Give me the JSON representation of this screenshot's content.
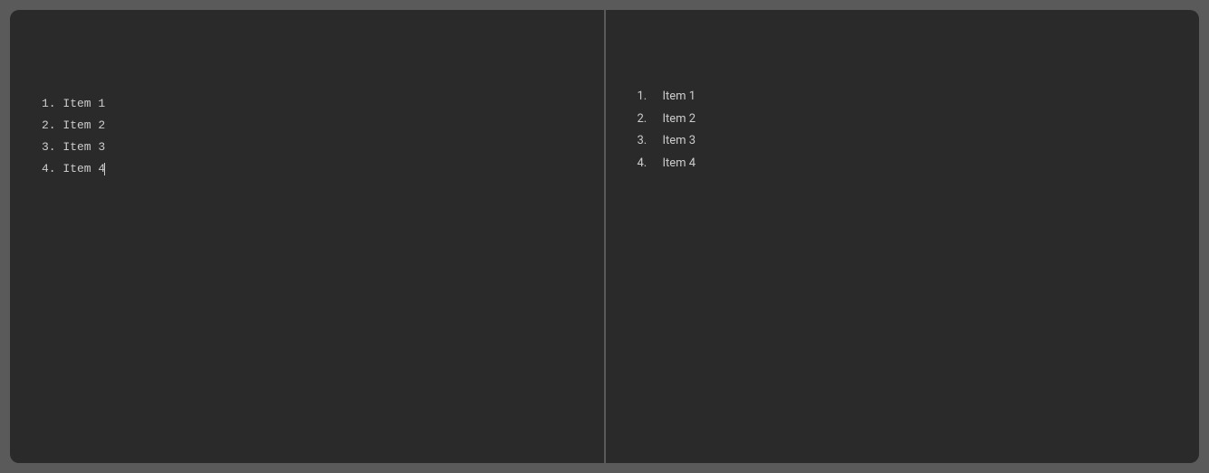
{
  "editor": {
    "lines": [
      "1. Item 1",
      "2. Item 2",
      "3. Item 3",
      "4. Item 4"
    ],
    "cursor_after_line": 3
  },
  "preview": {
    "items": [
      {
        "marker": "1.",
        "text": "Item 1"
      },
      {
        "marker": "2.",
        "text": "Item 2"
      },
      {
        "marker": "3.",
        "text": "Item 3"
      },
      {
        "marker": "4.",
        "text": "Item 4"
      }
    ]
  }
}
